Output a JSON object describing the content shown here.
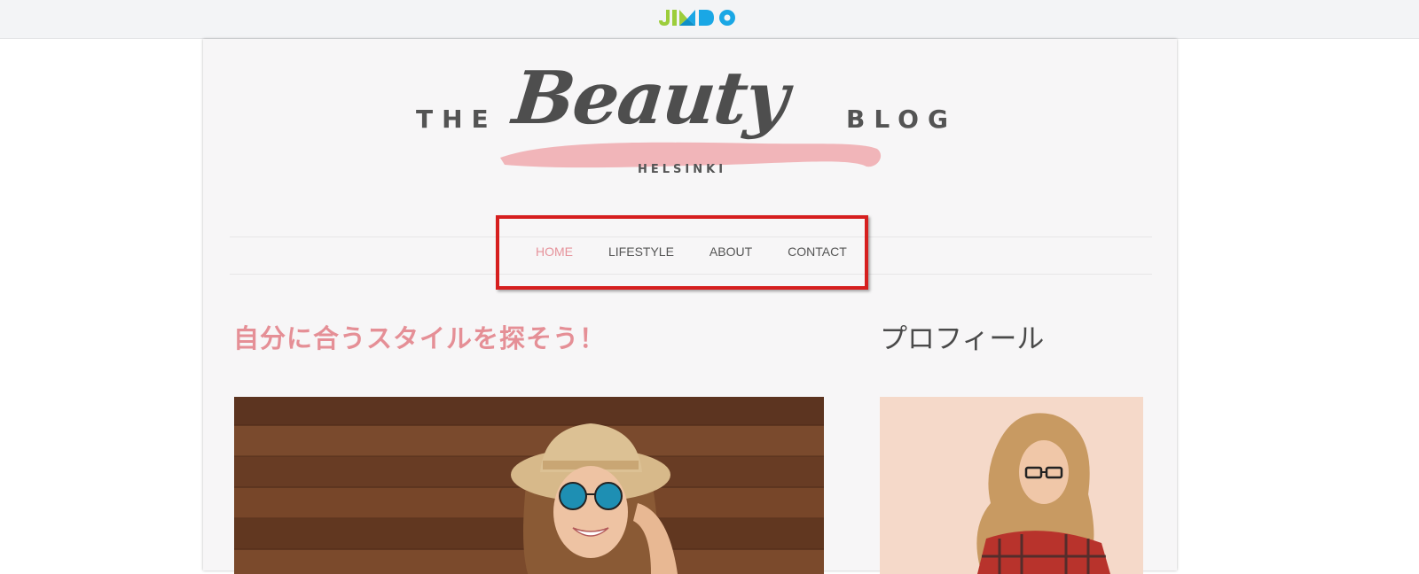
{
  "topbar": {
    "brand": "JIMDO",
    "brand_colors": [
      "#9ccd3b",
      "#1aa7e5"
    ]
  },
  "logo": {
    "the": "THE",
    "script": "Beauty",
    "blog": "BLOG",
    "sub": "HELSINKI",
    "stroke_color": "#efaeb1"
  },
  "nav": {
    "items": [
      {
        "label": "HOME",
        "active": true
      },
      {
        "label": "LIFESTYLE",
        "active": false
      },
      {
        "label": "ABOUT",
        "active": false
      },
      {
        "label": "CONTACT",
        "active": false
      }
    ],
    "highlight_color": "#d61f1f"
  },
  "main": {
    "title": "自分に合うスタイルを探そう！"
  },
  "sidebar": {
    "title": "プロフィール"
  },
  "colors": {
    "accent": "#e58f96",
    "page_bg": "#f7f6f7",
    "text": "#555555"
  }
}
